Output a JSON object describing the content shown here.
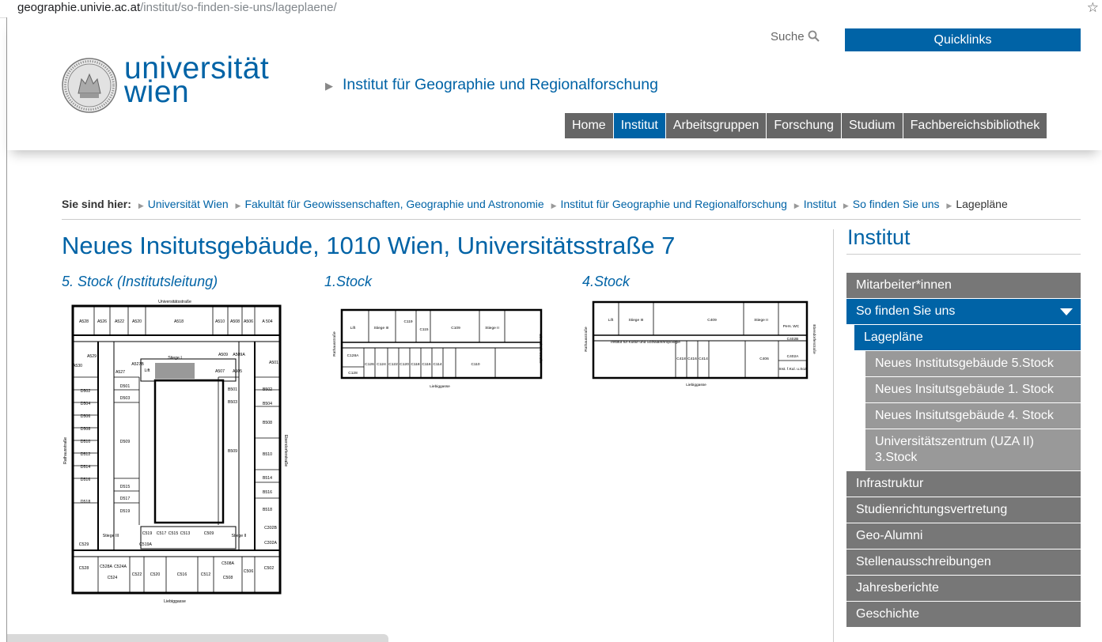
{
  "browser": {
    "url_host": "geographie.univie.ac.at",
    "url_path": "/institut/so-finden-sie-uns/lageplaene/",
    "bookmark_icon": "star-icon"
  },
  "header": {
    "logo_line1": "universität",
    "logo_line2": "wien",
    "search_label": "Suche",
    "quicklinks_label": "Quicklinks",
    "site_title": "Institut für Geographie und Regionalforschung",
    "nav": [
      "Home",
      "Institut",
      "Arbeitsgruppen",
      "Forschung",
      "Studium",
      "Fachbereichsbibliothek"
    ],
    "nav_active": "Institut",
    "brand_color": "#0063a6"
  },
  "breadcrumb": {
    "label": "Sie sind hier:",
    "items": [
      "Universität Wien",
      "Fakultät für Geowissenschaften, Geographie und Astronomie",
      "Institut für Geographie und Regionalforschung",
      "Institut",
      "So finden Sie uns"
    ],
    "current": "Lagepläne"
  },
  "main": {
    "title": "Neues Insitutsgebäude, 1010 Wien, Universitätsstraße 7",
    "plans": [
      {
        "heading": "5. Stock (Institutsleitung)",
        "streets": {
          "top": "Universitätsstraße",
          "bottom": "Liebiggasse",
          "left": "Rathausstraße",
          "right": "Ebendorferstraße"
        },
        "rooms_top": [
          "A528",
          "A526",
          "A522",
          "A520",
          "A518",
          "A510",
          "A508",
          "A506",
          "A 504"
        ],
        "rooms_left": [
          "D502",
          "D504",
          "D506",
          "D508",
          "D510",
          "D512",
          "D514",
          "D516",
          "D518"
        ],
        "rooms_inner_left": [
          "D501",
          "D503",
          "D509",
          "D515",
          "D517",
          "D519"
        ],
        "rooms_right": [
          "B502",
          "B504",
          "B508",
          "B510",
          "B514",
          "B516",
          "B518"
        ],
        "rooms_inner_right": [
          "B501",
          "B503",
          "B509"
        ],
        "rooms_bottom": [
          "C528",
          "C524",
          "C522",
          "C520",
          "C516",
          "C512",
          "C508",
          "C506",
          "C502"
        ],
        "rooms_courtyard": [
          "C519",
          "C517",
          "C515",
          "C513",
          "C509"
        ],
        "misc": [
          "A529",
          "A527",
          "A527B",
          "Lift",
          "Stiege I",
          "A509",
          "A509A",
          "A507",
          "A505",
          "A530",
          "A501",
          "Stiege III",
          "Stiege II",
          "C529",
          "C302B",
          "C302A",
          "C528A",
          "C524A",
          "C508A",
          "C519A"
        ]
      },
      {
        "heading": "1.Stock",
        "streets": {
          "bottom": "Liebiggasse",
          "left": "Rathausstraße",
          "right": "Ebendorferstraße"
        },
        "rooms": [
          "C119",
          "C115",
          "C109",
          "C128A",
          "C128",
          "C126",
          "C124",
          "C122",
          "C120",
          "C118",
          "C116",
          "C114",
          "C110"
        ],
        "misc": [
          "Lift",
          "Stiege III",
          "Stiege II"
        ]
      },
      {
        "heading": "4.Stock",
        "streets": {
          "bottom": "Liebiggasse",
          "left": "Rathausstraße",
          "right": "Ebendorferstraße"
        },
        "rooms": [
          "C409",
          "C418",
          "C416",
          "C414",
          "C406",
          "C402B",
          "C402A"
        ],
        "misc": [
          "Lift",
          "Stiege III",
          "Stiege II",
          "Pers. WC",
          "Institut für Kultur und Sozialanthropologie",
          "Inst. f.Kul. u.Soz"
        ]
      }
    ]
  },
  "sidebar": {
    "title": "Institut",
    "items": [
      {
        "label": "Mitarbeiter*innen",
        "level": 0
      },
      {
        "label": "So finden Sie uns",
        "level": 0,
        "active": true
      },
      {
        "label": "Lagepläne",
        "level": 1,
        "active": true
      },
      {
        "label": "Neues Institutsgebäude 5.Stock",
        "level": 2
      },
      {
        "label": "Neues Insitutsgebäude 1. Stock",
        "level": 2
      },
      {
        "label": "Neues Insitutsgebäude 4. Stock",
        "level": 2
      },
      {
        "label": "Universitätszentrum (UZA II) 3.Stock",
        "level": 2
      },
      {
        "label": "Infrastruktur",
        "level": 0
      },
      {
        "label": "Studienrichtungsvertretung",
        "level": 0
      },
      {
        "label": "Geo-Alumni",
        "level": 0
      },
      {
        "label": "Stellenausschreibungen",
        "level": 0
      },
      {
        "label": "Jahresberichte",
        "level": 0
      },
      {
        "label": "Geschichte",
        "level": 0
      }
    ]
  }
}
